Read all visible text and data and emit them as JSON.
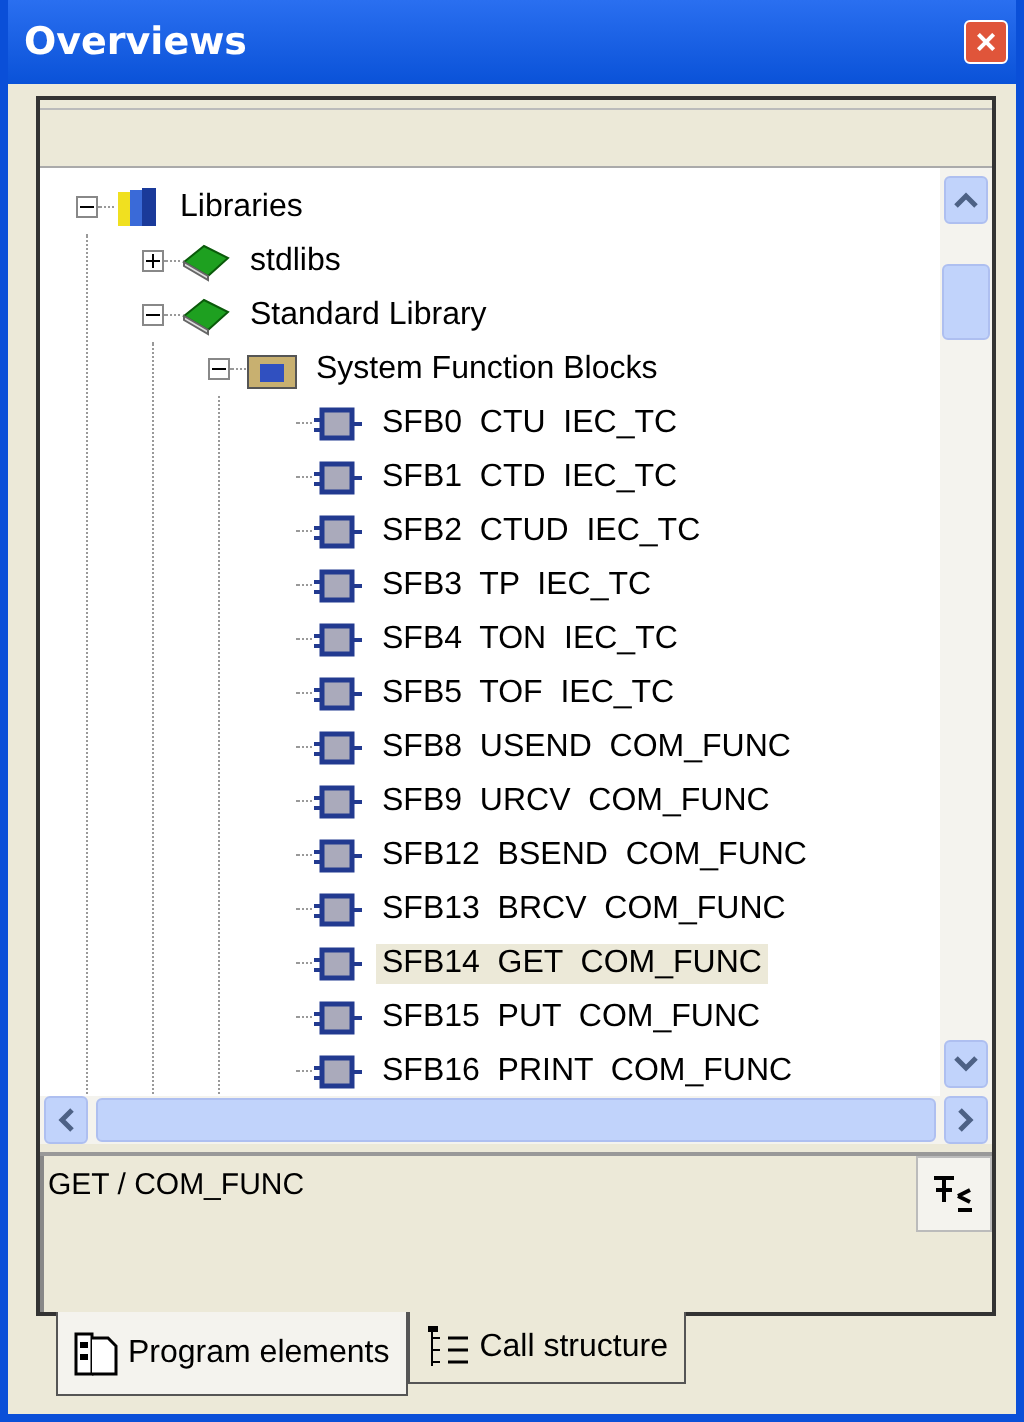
{
  "window": {
    "title": "Overviews",
    "close": "×"
  },
  "tree": [
    {
      "label": "Libraries",
      "kind": "libraries",
      "expanded": true,
      "selected": false,
      "children": [
        {
          "label": "stdlibs",
          "kind": "library",
          "expanded": false,
          "selected": false
        },
        {
          "label": "Standard Library",
          "kind": "library",
          "expanded": true,
          "selected": false,
          "children": [
            {
              "label": "System Function Blocks",
              "kind": "folder",
              "expanded": true,
              "selected": false,
              "children": [
                {
                  "label": "SFB0  CTU  IEC_TC",
                  "kind": "block",
                  "selected": false
                },
                {
                  "label": "SFB1  CTD  IEC_TC",
                  "kind": "block",
                  "selected": false
                },
                {
                  "label": "SFB2  CTUD  IEC_TC",
                  "kind": "block",
                  "selected": false
                },
                {
                  "label": "SFB3  TP  IEC_TC",
                  "kind": "block",
                  "selected": false
                },
                {
                  "label": "SFB4  TON  IEC_TC",
                  "kind": "block",
                  "selected": false
                },
                {
                  "label": "SFB5  TOF  IEC_TC",
                  "kind": "block",
                  "selected": false
                },
                {
                  "label": "SFB8  USEND  COM_FUNC",
                  "kind": "block",
                  "selected": false
                },
                {
                  "label": "SFB9  URCV  COM_FUNC",
                  "kind": "block",
                  "selected": false
                },
                {
                  "label": "SFB12  BSEND  COM_FUNC",
                  "kind": "block",
                  "selected": false
                },
                {
                  "label": "SFB13  BRCV  COM_FUNC",
                  "kind": "block",
                  "selected": false
                },
                {
                  "label": "SFB14  GET  COM_FUNC",
                  "kind": "block",
                  "selected": true
                },
                {
                  "label": "SFB15  PUT  COM_FUNC",
                  "kind": "block",
                  "selected": false
                },
                {
                  "label": "SFB16  PRINT  COM_FUNC",
                  "kind": "block",
                  "selected": false
                }
              ]
            }
          ]
        }
      ]
    }
  ],
  "info": {
    "text": "GET / COM_FUNC"
  },
  "tabs": [
    {
      "label": "Program elements",
      "kind": "elements",
      "selected": true
    },
    {
      "label": "Call structure",
      "kind": "calls",
      "selected": false
    }
  ]
}
